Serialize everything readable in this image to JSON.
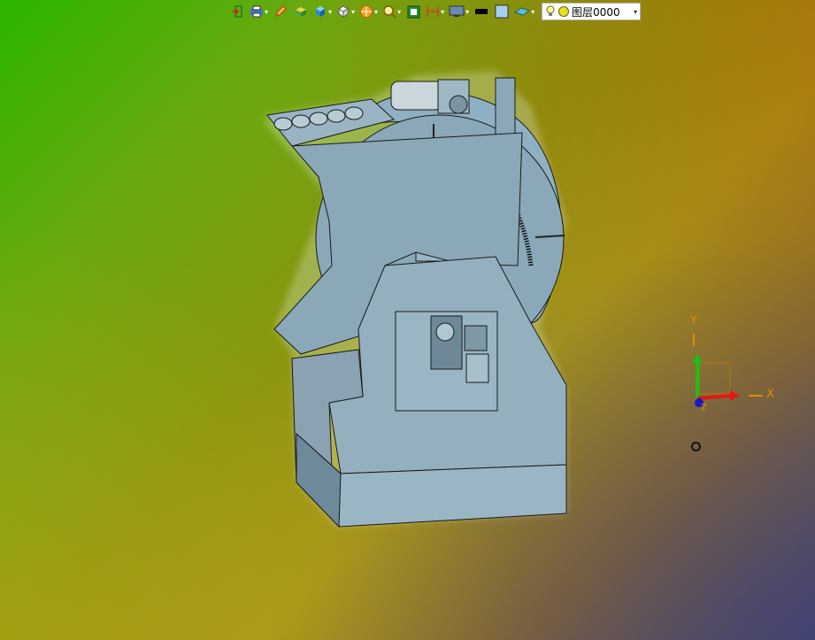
{
  "toolbar": {
    "icons": [
      "exit-icon",
      "print-icon",
      "pencil-icon",
      "layer-box-icon",
      "cube-solid-icon",
      "cube-wire-icon",
      "render-sphere-icon",
      "zoom-icon",
      "fit-screen-icon",
      "dimension-icon",
      "display-icon",
      "line-color-icon",
      "fill-color-icon",
      "plane-icon"
    ],
    "layer": {
      "label": "图层0000",
      "icon": "bulb-icon"
    }
  },
  "axes": {
    "x_label": "X",
    "y_label": "Y",
    "z_label": "Z"
  },
  "colors": {
    "model_fill": "#8aa8b8",
    "model_edge": "#1a1a1a",
    "accent": "#e08a10"
  }
}
